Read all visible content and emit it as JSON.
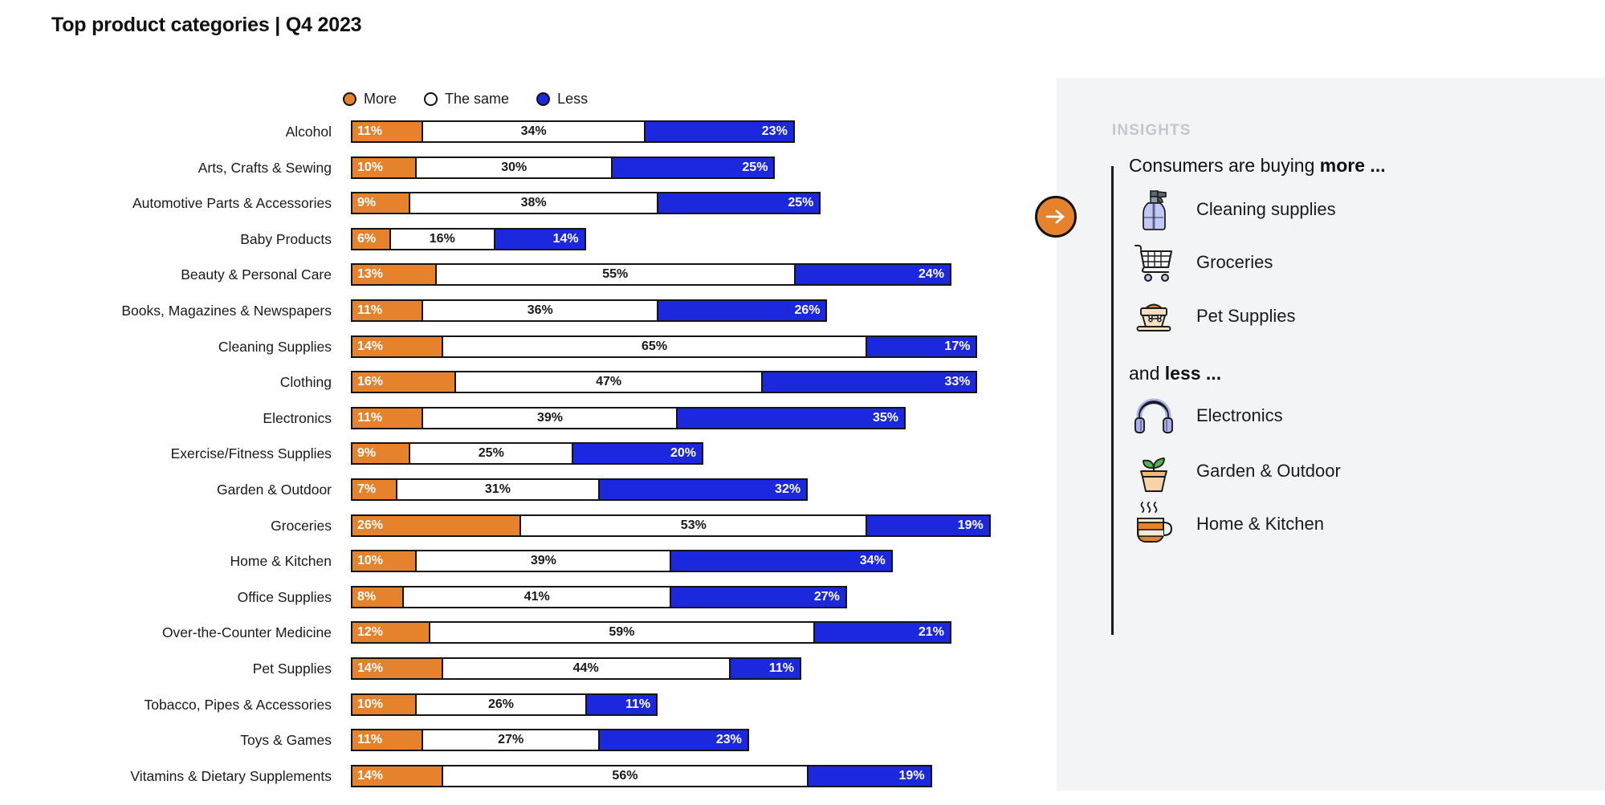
{
  "title": "Top product categories | Q4 2023",
  "legend": {
    "items": [
      {
        "label": "More",
        "color": "#E5822B",
        "key": "more"
      },
      {
        "label": "The same",
        "color": "#FFFFFF",
        "key": "same"
      },
      {
        "label": "Less",
        "color": "#1B28DD",
        "key": "less"
      }
    ]
  },
  "colors": {
    "more": "#E5822B",
    "same": "#FFFFFF",
    "less": "#1B28DD",
    "outline": "#141414",
    "panel_bg": "#F3F4F6",
    "kicker": "#C2C7CF"
  },
  "chart_data": {
    "type": "bar",
    "title": "Top product categories | Q4 2023",
    "xlabel": "",
    "ylabel": "",
    "xlim": [
      0,
      100
    ],
    "grid": false,
    "legend_position": "top",
    "stacked": true,
    "orientation": "horizontal",
    "unit": "%",
    "categories": [
      "Alcohol",
      "Arts, Crafts & Sewing",
      "Automotive Parts & Accessories",
      "Baby Products",
      "Beauty & Personal Care",
      "Books, Magazines & Newspapers",
      "Cleaning Supplies",
      "Clothing",
      "Electronics",
      "Exercise/Fitness Supplies",
      "Garden & Outdoor",
      "Groceries",
      "Home & Kitchen",
      "Office Supplies",
      "Over-the-Counter Medicine",
      "Pet Supplies",
      "Tobacco, Pipes & Accessories",
      "Toys & Games",
      "Vitamins & Dietary Supplements"
    ],
    "series": [
      {
        "name": "More",
        "color": "#E5822B",
        "values": [
          11,
          10,
          9,
          6,
          13,
          11,
          14,
          16,
          11,
          9,
          7,
          26,
          10,
          8,
          12,
          14,
          10,
          11,
          14
        ],
        "labels": [
          "11%",
          "10%",
          "9%",
          "6%",
          "13%",
          "11%",
          "14%",
          "16%",
          "11%",
          "9%",
          "7%",
          "26%",
          "10%",
          "8%",
          "12%",
          "14%",
          "10%",
          "11%",
          "14%"
        ]
      },
      {
        "name": "The same",
        "color": "#FFFFFF",
        "values": [
          34,
          30,
          38,
          16,
          55,
          36,
          65,
          47,
          39,
          25,
          31,
          53,
          39,
          41,
          59,
          44,
          26,
          27,
          56
        ],
        "labels": [
          "34%",
          "30%",
          "38%",
          "16%",
          "55%",
          "36%",
          "65%",
          "47%",
          "39%",
          "25%",
          "31%",
          "53%",
          "39%",
          "41%",
          "59%",
          "44%",
          "26%",
          "27%",
          "56%"
        ]
      },
      {
        "name": "Less",
        "color": "#1B28DD",
        "values": [
          23,
          25,
          25,
          14,
          24,
          26,
          17,
          33,
          35,
          20,
          32,
          19,
          34,
          27,
          21,
          11,
          11,
          23,
          19
        ],
        "labels": [
          "23%",
          "25%",
          "25%",
          "14%",
          "24%",
          "26%",
          "17%",
          "33%",
          "35%",
          "20%",
          "32%",
          "19%",
          "34%",
          "27%",
          "21%",
          "11%",
          "11%",
          "23%",
          "19%"
        ]
      }
    ]
  },
  "insights": {
    "kicker": "INSIGHTS",
    "arrow_icon": "arrow-right-icon",
    "more_heading_prefix": "Consumers are buying ",
    "more_heading_emphasis": "more ...",
    "more_items": [
      {
        "label": "Cleaning supplies",
        "icon": "spray-bottle-icon"
      },
      {
        "label": "Groceries",
        "icon": "shopping-cart-icon"
      },
      {
        "label": "Pet Supplies",
        "icon": "pet-food-bowl-icon"
      }
    ],
    "less_heading_prefix": "and ",
    "less_heading_emphasis": "less ...",
    "less_items": [
      {
        "label": "Electronics",
        "icon": "headphones-icon"
      },
      {
        "label": "Garden & Outdoor",
        "icon": "potted-plant-icon"
      },
      {
        "label": "Home & Kitchen",
        "icon": "steaming-mug-icon"
      }
    ]
  }
}
